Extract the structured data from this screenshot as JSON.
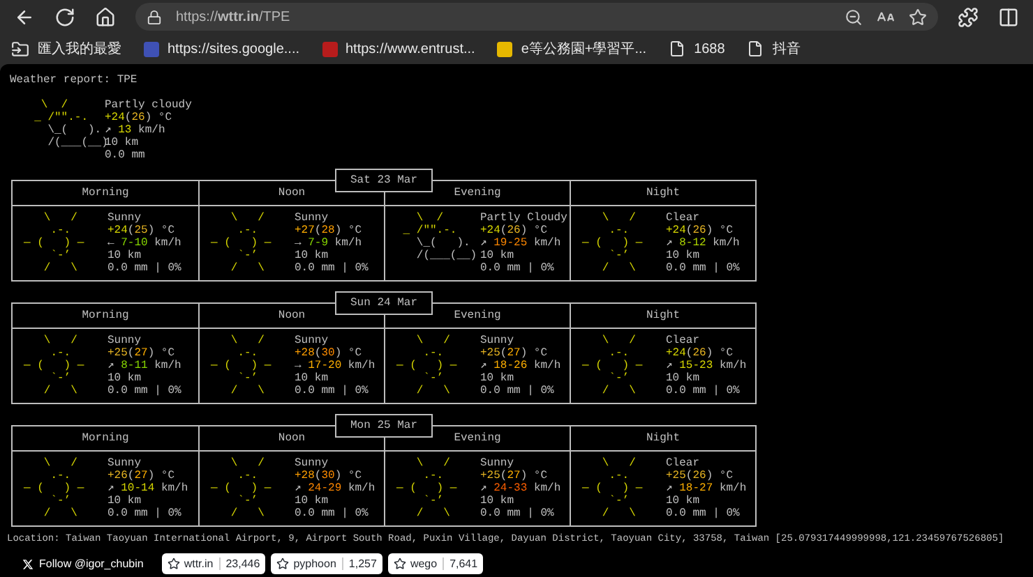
{
  "browser": {
    "url": "https://**wttr.in**/TPE",
    "bookmarks": [
      {
        "label": "匯入我的最愛",
        "kind": "import"
      },
      {
        "label": "https://sites.google....",
        "kind": "site",
        "color": "#3f51b5"
      },
      {
        "label": "https://www.entrust...",
        "kind": "site",
        "color": "#b71c1c"
      },
      {
        "label": "e等公務園+學習平...",
        "kind": "site",
        "color": "#e6b800"
      },
      {
        "label": "1688",
        "kind": "file"
      },
      {
        "label": "抖音",
        "kind": "file"
      }
    ]
  },
  "report_title": "Weather report: TPE",
  "current": {
    "art": [
      "   \\  /",
      "  _ /\"\".-.",
      "    \\_(   ).",
      "    /(___(__)"
    ],
    "kind": "partly_cloudy",
    "lines": [
      [
        {
          "text": "Partly cloudy"
        }
      ],
      [
        {
          "text": "+24",
          "color": "#d7d700"
        },
        {
          "text": "("
        },
        {
          "text": "26",
          "color": "#e6b422"
        },
        {
          "text": ") °C"
        }
      ],
      [
        {
          "text": "↗ "
        },
        {
          "text": "13",
          "color": "#d7d700"
        },
        {
          "text": " km/h"
        }
      ],
      [
        {
          "text": "10 km"
        }
      ],
      [
        {
          "text": "0.0 mm"
        }
      ]
    ]
  },
  "days": [
    {
      "date": "Sat 23 Mar",
      "periods": [
        {
          "label": "Morning",
          "kind": "sunny",
          "art": [
            "   \\   /",
            "    .-.",
            "― (   ) ―",
            "    `-’",
            "   /   \\"
          ],
          "lines": [
            [
              {
                "text": "Sunny"
              }
            ],
            [
              {
                "text": "+24",
                "color": "#d7d700"
              },
              {
                "text": "("
              },
              {
                "text": "25",
                "color": "#e6b422"
              },
              {
                "text": ") °C"
              }
            ],
            [
              {
                "text": "← "
              },
              {
                "text": "7-10",
                "color": "#87d700"
              },
              {
                "text": " km/h"
              }
            ],
            [
              {
                "text": "10 km"
              }
            ],
            [
              {
                "text": "0.0 mm | 0%"
              }
            ]
          ]
        },
        {
          "label": "Noon",
          "kind": "sunny",
          "art": [
            "   \\   /",
            "    .-.",
            "― (   ) ―",
            "    `-’",
            "   /   \\"
          ],
          "lines": [
            [
              {
                "text": "Sunny"
              }
            ],
            [
              {
                "text": "+27",
                "color": "#ffaf00"
              },
              {
                "text": "("
              },
              {
                "text": "28",
                "color": "#ff9f00"
              },
              {
                "text": ") °C"
              }
            ],
            [
              {
                "text": "→ "
              },
              {
                "text": "7-9",
                "color": "#87d700"
              },
              {
                "text": " km/h"
              }
            ],
            [
              {
                "text": "10 km"
              }
            ],
            [
              {
                "text": "0.0 mm | 0%"
              }
            ]
          ]
        },
        {
          "label": "Evening",
          "kind": "partly_cloudy",
          "art": [
            "   \\  /",
            " _ /\"\".-.",
            "   \\_(   ).",
            "   /(___(__)"
          ],
          "lines": [
            [
              {
                "text": "Partly Cloudy"
              }
            ],
            [
              {
                "text": "+24",
                "color": "#d7d700"
              },
              {
                "text": "("
              },
              {
                "text": "26",
                "color": "#e6b422"
              },
              {
                "text": ") °C"
              }
            ],
            [
              {
                "text": "↗ "
              },
              {
                "text": "19-25",
                "color": "#ff8700"
              },
              {
                "text": " km/h"
              }
            ],
            [
              {
                "text": "10 km"
              }
            ],
            [
              {
                "text": "0.0 mm | 0%"
              }
            ]
          ]
        },
        {
          "label": "Night",
          "kind": "clear",
          "art": [
            "   \\   /",
            "    .-.",
            "― (   ) ―",
            "    `-’",
            "   /   \\"
          ],
          "lines": [
            [
              {
                "text": "Clear"
              }
            ],
            [
              {
                "text": "+24",
                "color": "#d7d700"
              },
              {
                "text": "("
              },
              {
                "text": "26",
                "color": "#e6b422"
              },
              {
                "text": ") °C"
              }
            ],
            [
              {
                "text": "↗ "
              },
              {
                "text": "8-12",
                "color": "#afd700"
              },
              {
                "text": " km/h"
              }
            ],
            [
              {
                "text": "10 km"
              }
            ],
            [
              {
                "text": "0.0 mm | 0%"
              }
            ]
          ]
        }
      ]
    },
    {
      "date": "Sun 24 Mar",
      "periods": [
        {
          "label": "Morning",
          "kind": "sunny",
          "art": [
            "   \\   /",
            "    .-.",
            "― (   ) ―",
            "    `-’",
            "   /   \\"
          ],
          "lines": [
            [
              {
                "text": "Sunny"
              }
            ],
            [
              {
                "text": "+25",
                "color": "#e6b422"
              },
              {
                "text": "("
              },
              {
                "text": "27",
                "color": "#ffaf00"
              },
              {
                "text": ") °C"
              }
            ],
            [
              {
                "text": "↗ "
              },
              {
                "text": "8-11",
                "color": "#87d700"
              },
              {
                "text": " km/h"
              }
            ],
            [
              {
                "text": "10 km"
              }
            ],
            [
              {
                "text": "0.0 mm | 0%"
              }
            ]
          ]
        },
        {
          "label": "Noon",
          "kind": "sunny",
          "art": [
            "   \\   /",
            "    .-.",
            "― (   ) ―",
            "    `-’",
            "   /   \\"
          ],
          "lines": [
            [
              {
                "text": "Sunny"
              }
            ],
            [
              {
                "text": "+28",
                "color": "#ff9f00"
              },
              {
                "text": "("
              },
              {
                "text": "30",
                "color": "#ff8c00"
              },
              {
                "text": ") °C"
              }
            ],
            [
              {
                "text": "→ "
              },
              {
                "text": "17-20",
                "color": "#ffaf00"
              },
              {
                "text": " km/h"
              }
            ],
            [
              {
                "text": "10 km"
              }
            ],
            [
              {
                "text": "0.0 mm | 0%"
              }
            ]
          ]
        },
        {
          "label": "Evening",
          "kind": "sunny",
          "art": [
            "   \\   /",
            "    .-.",
            "― (   ) ―",
            "    `-’",
            "   /   \\"
          ],
          "lines": [
            [
              {
                "text": "Sunny"
              }
            ],
            [
              {
                "text": "+25",
                "color": "#e6b422"
              },
              {
                "text": "("
              },
              {
                "text": "27",
                "color": "#ffaf00"
              },
              {
                "text": ") °C"
              }
            ],
            [
              {
                "text": "↗ "
              },
              {
                "text": "18-26",
                "color": "#ffaf00"
              },
              {
                "text": " km/h"
              }
            ],
            [
              {
                "text": "10 km"
              }
            ],
            [
              {
                "text": "0.0 mm | 0%"
              }
            ]
          ]
        },
        {
          "label": "Night",
          "kind": "clear",
          "art": [
            "   \\   /",
            "    .-.",
            "― (   ) ―",
            "    `-’",
            "   /   \\"
          ],
          "lines": [
            [
              {
                "text": "Clear"
              }
            ],
            [
              {
                "text": "+24",
                "color": "#d7d700"
              },
              {
                "text": "("
              },
              {
                "text": "26",
                "color": "#e6b422"
              },
              {
                "text": ") °C"
              }
            ],
            [
              {
                "text": "↗ "
              },
              {
                "text": "15-23",
                "color": "#d7d700"
              },
              {
                "text": " km/h"
              }
            ],
            [
              {
                "text": "10 km"
              }
            ],
            [
              {
                "text": "0.0 mm | 0%"
              }
            ]
          ]
        }
      ]
    },
    {
      "date": "Mon 25 Mar",
      "periods": [
        {
          "label": "Morning",
          "kind": "sunny",
          "art": [
            "   \\   /",
            "    .-.",
            "― (   ) ―",
            "    `-’",
            "   /   \\"
          ],
          "lines": [
            [
              {
                "text": "Sunny"
              }
            ],
            [
              {
                "text": "+26",
                "color": "#e6b422"
              },
              {
                "text": "("
              },
              {
                "text": "27",
                "color": "#ffaf00"
              },
              {
                "text": ") °C"
              }
            ],
            [
              {
                "text": "↗ "
              },
              {
                "text": "10-14",
                "color": "#d7d700"
              },
              {
                "text": " km/h"
              }
            ],
            [
              {
                "text": "10 km"
              }
            ],
            [
              {
                "text": "0.0 mm | 0%"
              }
            ]
          ]
        },
        {
          "label": "Noon",
          "kind": "sunny",
          "art": [
            "   \\   /",
            "    .-.",
            "― (   ) ―",
            "    `-’",
            "   /   \\"
          ],
          "lines": [
            [
              {
                "text": "Sunny"
              }
            ],
            [
              {
                "text": "+28",
                "color": "#ff9f00"
              },
              {
                "text": "("
              },
              {
                "text": "30",
                "color": "#ff8c00"
              },
              {
                "text": ") °C"
              }
            ],
            [
              {
                "text": "↗ "
              },
              {
                "text": "24-29",
                "color": "#ff8700"
              },
              {
                "text": " km/h"
              }
            ],
            [
              {
                "text": "10 km"
              }
            ],
            [
              {
                "text": "0.0 mm | 0%"
              }
            ]
          ]
        },
        {
          "label": "Evening",
          "kind": "sunny",
          "art": [
            "   \\   /",
            "    .-.",
            "― (   ) ―",
            "    `-’",
            "   /   \\"
          ],
          "lines": [
            [
              {
                "text": "Sunny"
              }
            ],
            [
              {
                "text": "+25",
                "color": "#e6b422"
              },
              {
                "text": "("
              },
              {
                "text": "27",
                "color": "#ffaf00"
              },
              {
                "text": ") °C"
              }
            ],
            [
              {
                "text": "↗ "
              },
              {
                "text": "24-33",
                "color": "#ff5f00"
              },
              {
                "text": " km/h"
              }
            ],
            [
              {
                "text": "10 km"
              }
            ],
            [
              {
                "text": "0.0 mm | 0%"
              }
            ]
          ]
        },
        {
          "label": "Night",
          "kind": "clear",
          "art": [
            "   \\   /",
            "    .-.",
            "― (   ) ―",
            "    `-’",
            "   /   \\"
          ],
          "lines": [
            [
              {
                "text": "Clear"
              }
            ],
            [
              {
                "text": "+25",
                "color": "#e6b422"
              },
              {
                "text": "("
              },
              {
                "text": "26",
                "color": "#e6b422"
              },
              {
                "text": ") °C"
              }
            ],
            [
              {
                "text": "↗ "
              },
              {
                "text": "18-27",
                "color": "#ffaf00"
              },
              {
                "text": " km/h"
              }
            ],
            [
              {
                "text": "10 km"
              }
            ],
            [
              {
                "text": "0.0 mm | 0%"
              }
            ]
          ]
        }
      ]
    }
  ],
  "location": "Location: Taiwan Taoyuan International Airport, 9, Airport South Road, Puxin Village, Dayuan District, Taoyuan City, 33758, Taiwan [25.079317449999998,121.23459767526805]",
  "follow": "Follow @igor_chubin",
  "repos": [
    {
      "name": "wttr.in",
      "stars_count": "23,446"
    },
    {
      "name": "pyphoon",
      "stars_count": "1,257"
    },
    {
      "name": "wego",
      "stars_count": "7,641"
    }
  ]
}
